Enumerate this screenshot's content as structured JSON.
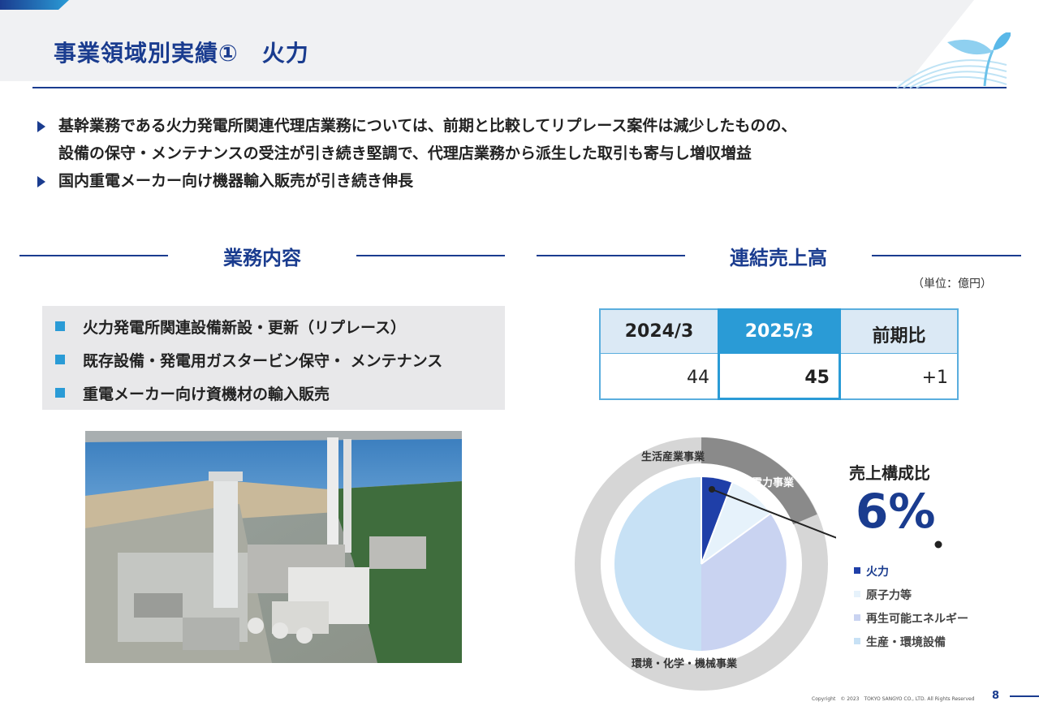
{
  "title": "事業領域別実績①　火力",
  "bullets": [
    "基幹業務である火力発電所関連代理店業務については、前期と比較してリプレース案件は減少したものの、",
    "設備の保守・メンテナンスの受注が引き続き堅調で、代理店業務から派生した取引も寄与し増収増益",
    "国内重電メーカー向け機器輸入販売が引き続き伸長"
  ],
  "business": {
    "heading": "業務内容",
    "items": [
      "火力発電所関連設備新設・更新（リプレース）",
      "既存設備・発電用ガスタービン保守・ メンテナンス",
      "重電メーカー向け資機材の輸入販売"
    ]
  },
  "sales": {
    "heading": "連結売上高",
    "unit": "（単位：億円）",
    "headers": [
      "2024/3",
      "2025/3",
      "前期比"
    ],
    "values": [
      "44",
      "45",
      "+1"
    ]
  },
  "composition": {
    "title": "売上構成比",
    "value": "6%",
    "outer_labels": [
      "生活産業事業",
      "電力事業",
      "環境・化学・機械事業"
    ],
    "legend": [
      "火力",
      "原子力等",
      "再生可能エネルギー",
      "生産・環境設備"
    ]
  },
  "colors": {
    "brand": "#1a3c8f",
    "accent": "#2a9bd6",
    "thermal": "#1f3fa8",
    "nuclear": "#e6f2fb",
    "renewable": "#c9d3f1",
    "facility": "#c7e1f5",
    "outer_power": "#8a8a8a",
    "outer_other": "#d6d6d6"
  },
  "footer": {
    "copyright": "Copyright　© 2023　TOKYO SANGYO CO., LTD. All Rights Reserved",
    "page": "8"
  },
  "icons": [
    "leaf-logo-icon",
    "triangle-bullet-icon",
    "square-bullet-icon"
  ]
}
